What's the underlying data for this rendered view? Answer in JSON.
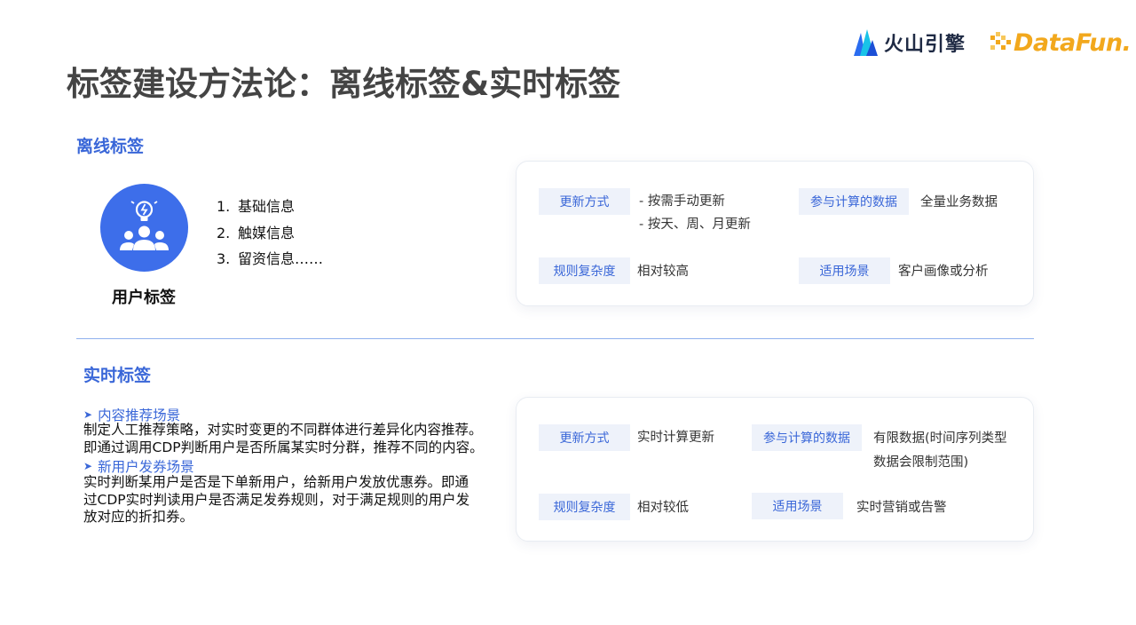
{
  "header": {
    "title": "标签建设方法论：离线标签&实时标签",
    "logo_volc": "火山引擎",
    "logo_datafun": "DataFun."
  },
  "offline": {
    "label": "离线标签",
    "avatar_label": "用户标签",
    "list": [
      {
        "num": "1.",
        "text": "基础信息"
      },
      {
        "num": "2.",
        "text": "触媒信息"
      },
      {
        "num": "3.",
        "text": "留资信息……"
      }
    ],
    "card": {
      "update_tag": "更新方式",
      "update_values": [
        "- 按需手动更新",
        "- 按天、周、月更新"
      ],
      "data_tag": "参与计算的数据",
      "data_value": "全量业务数据",
      "complexity_tag": "规则复杂度",
      "complexity_value": "相对较高",
      "scene_tag": "适用场景",
      "scene_value": "客户画像或分析"
    }
  },
  "realtime": {
    "label": "实时标签",
    "scenario1_title": "内容推荐场景",
    "scenario1_lines": [
      "制定人工推荐策略，对实时变更的不同群体进行差异化内容推荐。",
      "即通过调用CDP判断用户是否所属某实时分群，推荐不同的内容。"
    ],
    "scenario2_title": "新用户发券场景",
    "scenario2_lines": [
      "实时判断某用户是否是下单新用户，给新用户发放优惠券。即通",
      "过CDP实时判读用户是否满足发券规则，对于满足规则的用户发",
      "放对应的折扣券。"
    ],
    "card": {
      "update_tag": "更新方式",
      "update_value": "实时计算更新",
      "data_tag": "参与计算的数据",
      "data_values": [
        "有限数据(时间序列类型",
        "数据会限制范围)"
      ],
      "complexity_tag": "规则复杂度",
      "complexity_value": "相对较低",
      "scene_tag": "适用场景",
      "scene_value": "实时营销或告警"
    }
  },
  "colors": {
    "accent": "#3a67d8",
    "avatar_bg": "#3d6eea",
    "tag_bg": "#eef2fa",
    "title": "#444444",
    "datafun": "#f2a81d",
    "divider": "#8fb0ee"
  },
  "icons": {
    "avatar": "users-lightbulb-icon",
    "volc_logo": "mountain-logo-icon",
    "datafun_logo": "pixel-logo-icon",
    "bullet": "arrow-right-icon"
  }
}
